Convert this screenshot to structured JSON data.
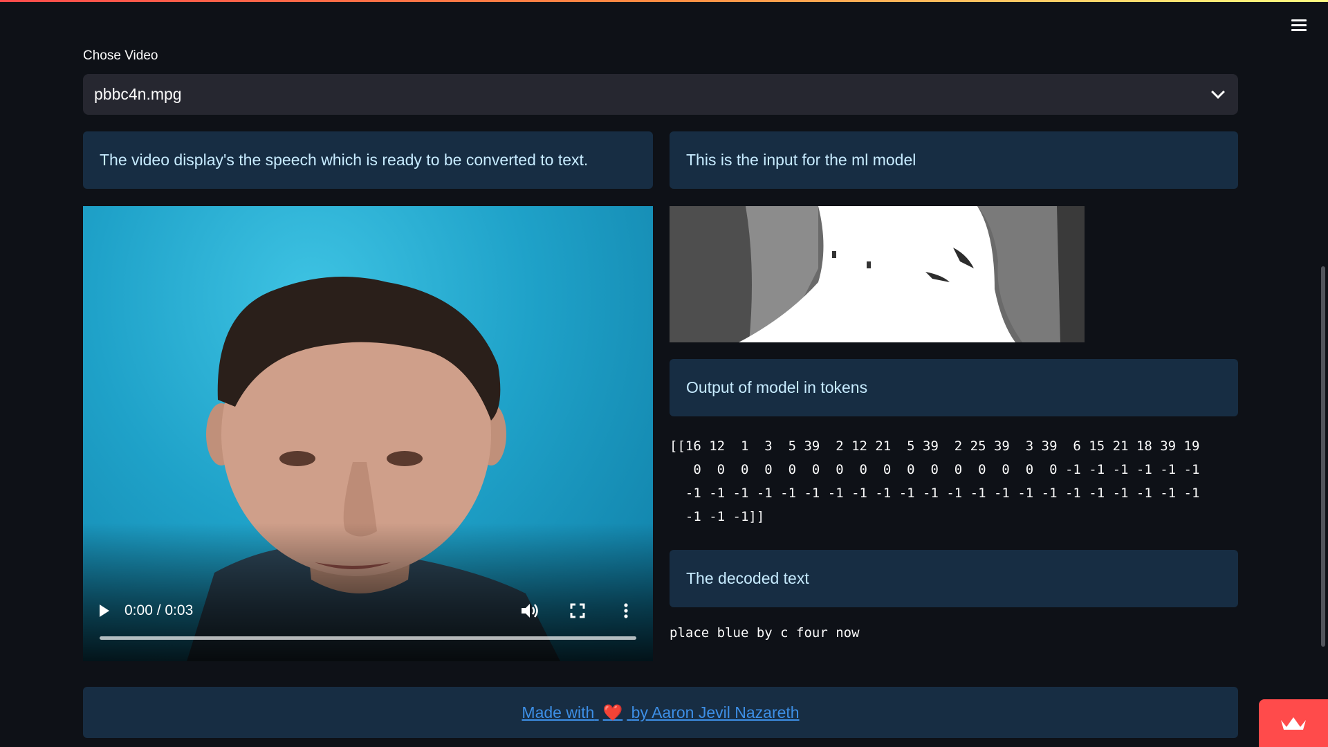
{
  "select": {
    "label": "Chose Video",
    "value": "pbbc4n.mpg"
  },
  "left_column": {
    "info": "The video display's the speech which is ready to be converted to text.",
    "video": {
      "time": "0:00 / 0:03",
      "icons": [
        "play-icon",
        "volume-icon",
        "fullscreen-icon",
        "more-options-icon"
      ]
    }
  },
  "right_column": {
    "info_input": "This is the input for the ml model",
    "info_tokens": "Output of model in tokens",
    "tokens_text": "[[16 12  1  3  5 39  2 12 21  5 39  2 25 39  3 39  6 15 21 18 39 19\n   0  0  0  0  0  0  0  0  0  0  0  0  0  0  0  0 -1 -1 -1 -1 -1 -1\n  -1 -1 -1 -1 -1 -1 -1 -1 -1 -1 -1 -1 -1 -1 -1 -1 -1 -1 -1 -1 -1 -1\n  -1 -1 -1]]",
    "info_decoded": "The decoded text",
    "decoded_text": "place blue by c four now"
  },
  "footer": {
    "prefix": "Made with",
    "heart": "❤️",
    "suffix": "by Aaron Jevil Nazareth"
  },
  "colors": {
    "background": "#0e1117",
    "info_box": "#172d43",
    "info_text": "#c7ebff",
    "link": "#3d8fe6",
    "accent": "#ff4b4b"
  }
}
